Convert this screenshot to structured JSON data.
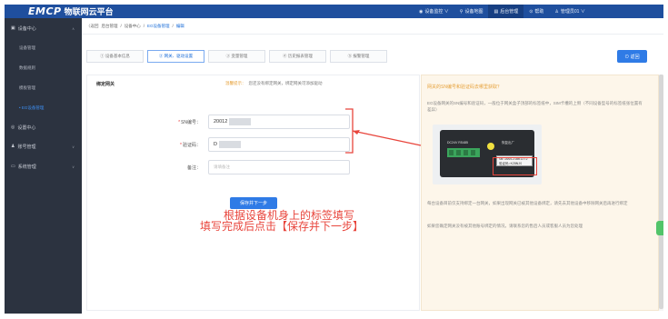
{
  "app": {
    "logo": "EMCP",
    "title": "物联网云平台"
  },
  "topnav": [
    {
      "icon": "monitor-icon",
      "glyph": "◉",
      "label": "设备监控 ∨",
      "active": false
    },
    {
      "icon": "map-icon",
      "glyph": "⚲",
      "label": "设备地图",
      "active": false
    },
    {
      "icon": "admin-icon",
      "glyph": "▤",
      "label": "后台管理",
      "active": true
    },
    {
      "icon": "help-icon",
      "glyph": "⊙",
      "label": "帮助",
      "active": false
    },
    {
      "icon": "user-icon",
      "glyph": "♙",
      "label": "管理员01 ∨",
      "active": false
    }
  ],
  "sidebar": {
    "groups": [
      {
        "icon": "device-center-icon",
        "glyph": "▣",
        "label": "设备中心",
        "chevron": "∧"
      },
      {
        "icon": "settings-center-icon",
        "glyph": "◎",
        "label": "设置中心",
        "chevron": ""
      },
      {
        "icon": "user-mgmt-icon",
        "glyph": "♟",
        "label": "账号管理",
        "chevron": "∨"
      },
      {
        "icon": "system-mgmt-icon",
        "glyph": "▭",
        "label": "系统管理",
        "chevron": "∨"
      }
    ],
    "sub_items": [
      {
        "label": "设备管理",
        "active": false
      },
      {
        "label": "数据规则",
        "active": false
      },
      {
        "label": "模板管理",
        "active": false
      },
      {
        "label": "• EG设备管理",
        "active": true
      }
    ]
  },
  "breadcrumb": {
    "back": "〈返回",
    "items": [
      "后台管理",
      "设备中心"
    ],
    "sep": "/",
    "current": "EG设备管理",
    "last": "编辑"
  },
  "tabs": [
    {
      "label": "① 设备基本信息",
      "active": false
    },
    {
      "label": "② 网关、驱动设置",
      "active": true
    },
    {
      "label": "③ 变量管理",
      "active": false
    },
    {
      "label": "④ 历史报表管理",
      "active": false
    },
    {
      "label": "⑤ 报警管理",
      "active": false
    }
  ],
  "return_button": "⊙ 返回",
  "form": {
    "title": "绑定网关",
    "hint_icon": "温馨提示：",
    "hint": "您还没有绑定网关，绑定网关可添加驱动",
    "sn_label": "SN编号：",
    "sn_value": "20012",
    "code_label": "验证码：",
    "code_value": "D",
    "remark_label": "备注：",
    "remark_placeholder": "请填备注",
    "save_button": "保存并下一步"
  },
  "annotations": {
    "note1": "根据设备机身上的标签填写",
    "note2": "填写完成后点击【保存并下一步】"
  },
  "help": {
    "title": "网关的SN编号和验证码去哪里获取？",
    "para1": "EG设备网关的SN编号和验证码，一般位于网关盒子顶部的标签纸中，SIM卡槽的上侧（不同设备型号的标签纸张位置有差异）",
    "para2": "每台设备目前仅支持绑定一台网关，如果出现网关已被其他设备绑定，请先去其他设备中移除网关后再进行绑定",
    "para3": "如果您确定网关没有被其他账号绑定的情况，请联系您的售后人员或客服人员为您处理",
    "device": {
      "port_label": "DC24V  RS485",
      "btn_label": "恢复出厂",
      "sn_text": "SN:200121861272",
      "code_text": "验证码:KZ8NJS"
    }
  }
}
